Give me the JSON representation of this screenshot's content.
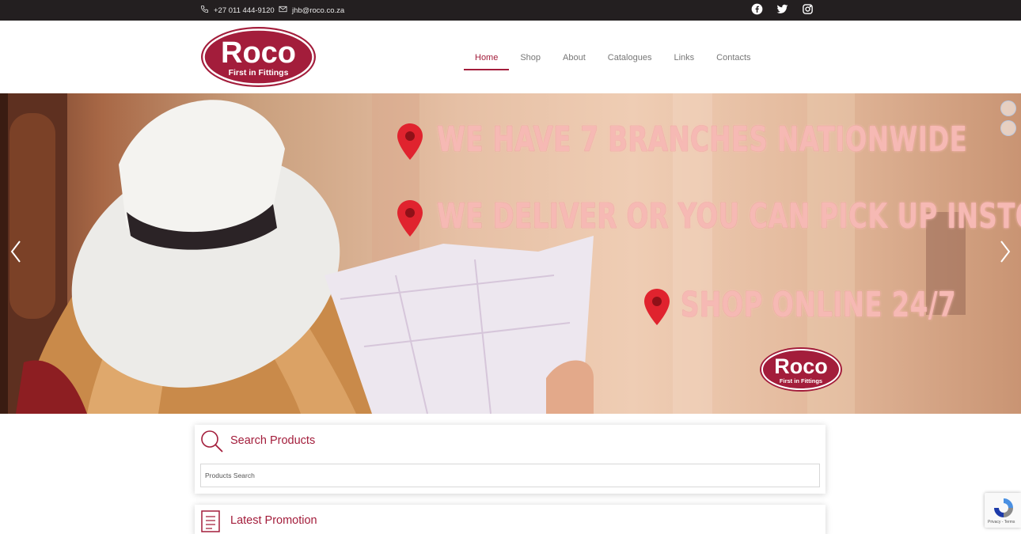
{
  "topbar": {
    "phone": "+27 011 444-9120",
    "email": "jhb@roco.co.za",
    "social": [
      "facebook-icon",
      "twitter-icon",
      "instagram-icon"
    ]
  },
  "brand": {
    "name": "Roco",
    "tagline": "First in Fittings",
    "color": "#a31d3b"
  },
  "nav": {
    "items": [
      "Home",
      "Shop",
      "About",
      "Catalogues",
      "Links",
      "Contacts"
    ],
    "active": "Home"
  },
  "hero": {
    "line1": "WE HAVE 7 BRANCHES NATIONWIDE",
    "line2": "WE DELIVER OR YOU CAN PICK UP INSTORE",
    "line3": "SHOP ONLINE 24/7",
    "pin_color": "#e0232e"
  },
  "search": {
    "title": "Search Products",
    "placeholder": "Products Search"
  },
  "promo": {
    "title": "Latest Promotion"
  },
  "recaptcha": {
    "links": "Privacy - Terms"
  }
}
